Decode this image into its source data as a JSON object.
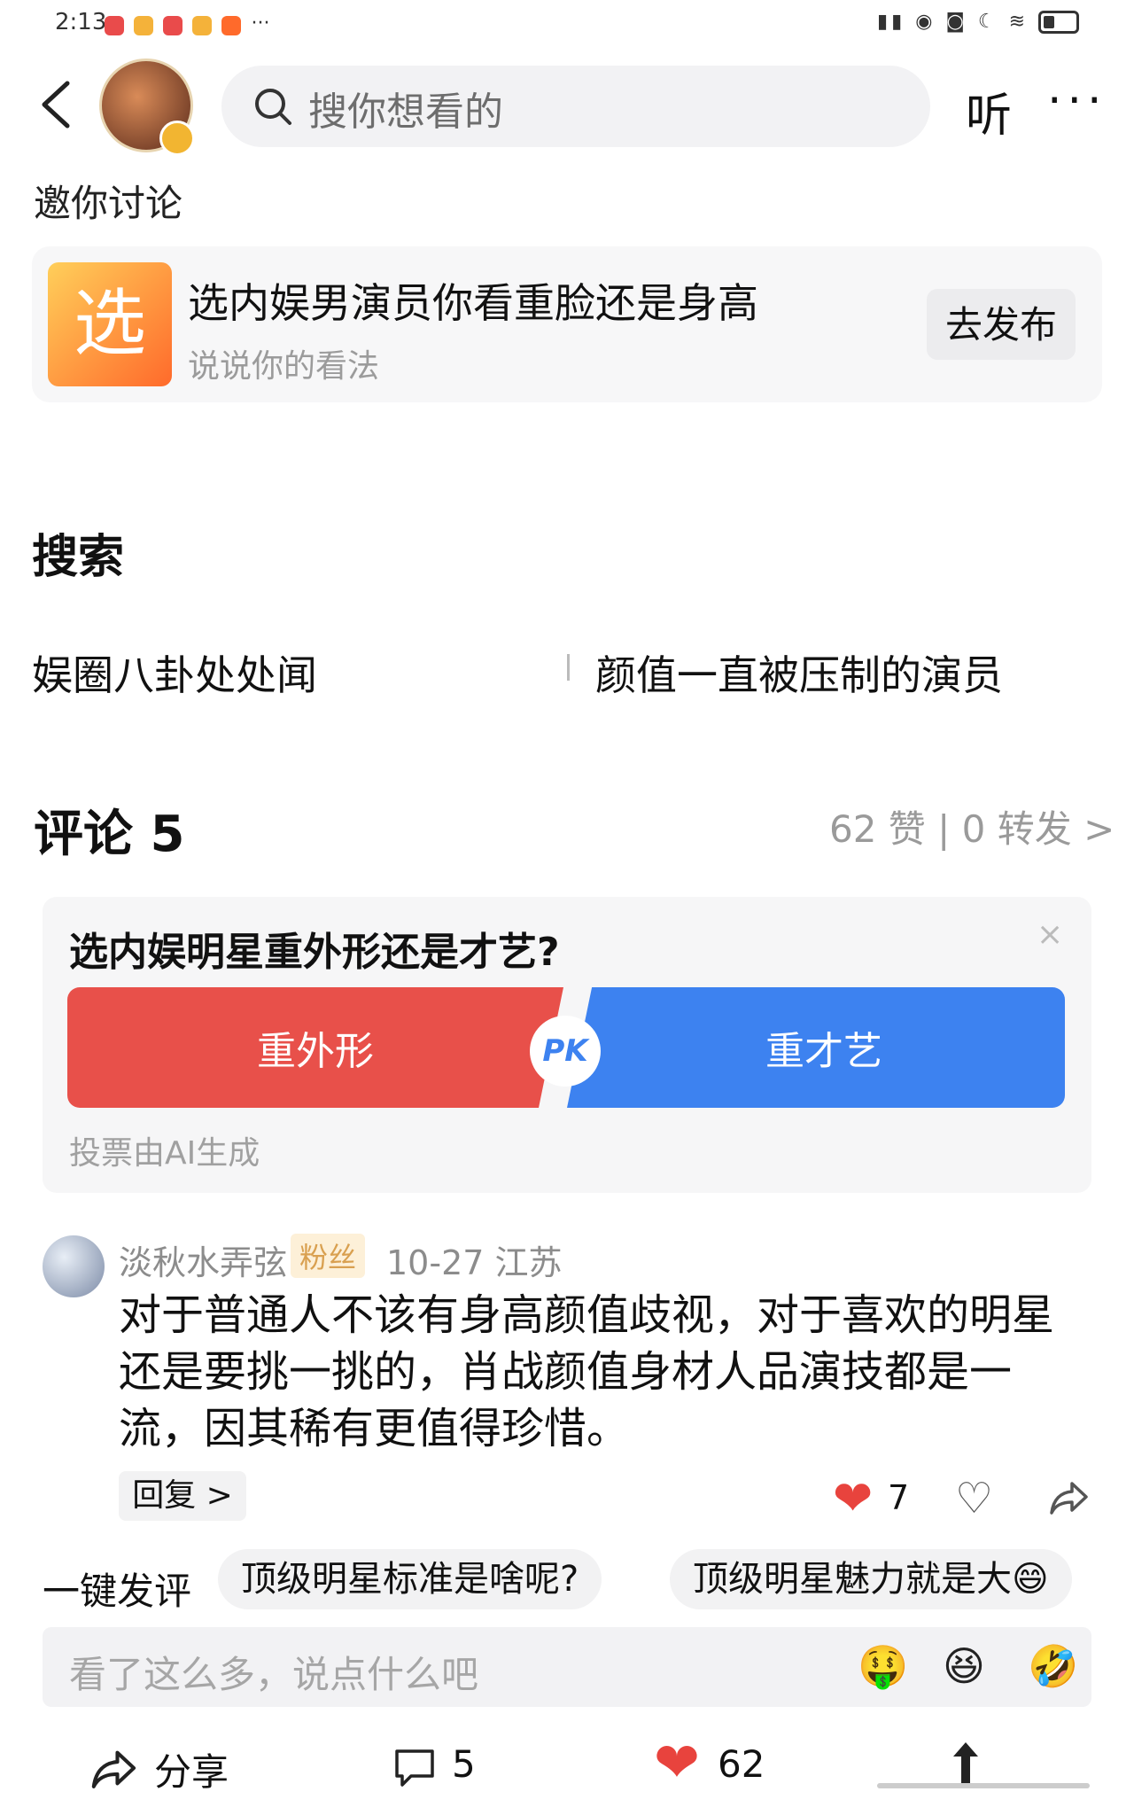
{
  "status": {
    "time": "2:13",
    "ellipsis": "···"
  },
  "header": {
    "search_placeholder": "搜你想看的",
    "listen_label": "听",
    "more_label": "···"
  },
  "invite": {
    "label": "邀你讨论",
    "topic_icon_text": "选",
    "topic_title": "选内娱男演员你看重脸还是身高",
    "topic_sub": "说说你的看法",
    "publish_label": "去发布"
  },
  "search_section": {
    "heading": "搜索",
    "links": [
      "娱圈八卦处处闻",
      "颜值一直被压制的演员"
    ]
  },
  "comments_header": {
    "title": "评论 5",
    "stats": "62 赞 | 0 转发 >"
  },
  "poll": {
    "question": "选内娱明星重外形还是才艺?",
    "close": "×",
    "option_left": "重外形",
    "option_right": "重才艺",
    "pk": "PK",
    "note": "投票由AI生成"
  },
  "comment": {
    "username": "淡秋水弄弦",
    "badge": "粉丝",
    "meta": "10-27  江苏",
    "body": "对于普通人不该有身高颜值歧视，对于喜欢的明星还是要挑一挑的，肖战颜值身材人品演技都是一流，因其稀有更值得珍惜。",
    "reply_label": "回复 >",
    "likes": "7"
  },
  "quick_reply": {
    "label": "一键发评",
    "chips": [
      "顶级明星标准是啥呢?",
      "顶级明星魅力就是大😄"
    ]
  },
  "input": {
    "placeholder": "看了这么多，说点什么吧",
    "emojis": [
      "🤑",
      "😆",
      "🤣"
    ]
  },
  "bottom_bar": {
    "share_label": "分享",
    "comment_count": "5",
    "like_count": "62"
  },
  "colors": {
    "like_red": "#e8433d",
    "pk_blue": "#3d82f0",
    "pk_red": "#e8504a"
  }
}
